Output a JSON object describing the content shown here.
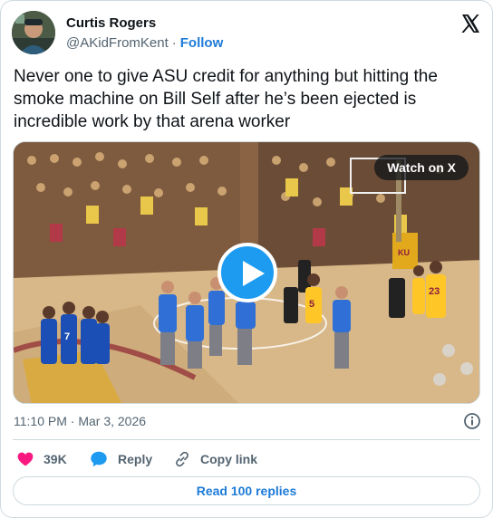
{
  "author": {
    "name": "Curtis Rogers",
    "handle": "@AKidFromKent",
    "separator": "·",
    "follow_label": "Follow"
  },
  "tweet": {
    "text": "Never one to give ASU credit for anything but hitting the smoke machine on Bill Self after he’s been ejected is incredible work by that arena worker"
  },
  "media": {
    "watch_label": "Watch on X",
    "play_icon": "play-icon",
    "scoreboard_text": "KU",
    "jersey_numbers": [
      "5",
      "23",
      "7"
    ]
  },
  "meta": {
    "timestamp": "11:10 PM · Mar 3, 2026"
  },
  "actions": {
    "like_count": "39K",
    "reply_label": "Reply",
    "copy_link_label": "Copy link"
  },
  "read_replies_label": "Read 100 replies",
  "colors": {
    "accent": "#1d9bf0",
    "link": "#1d7bd8",
    "like": "#f91880",
    "muted": "#536471",
    "border": "#cfd9de",
    "kansas_blue": "#1b4fb6",
    "asu_gold": "#ffc627"
  },
  "icons": [
    "x-logo-icon",
    "info-icon",
    "heart-icon",
    "reply-bubble-icon",
    "link-icon",
    "play-icon"
  ]
}
